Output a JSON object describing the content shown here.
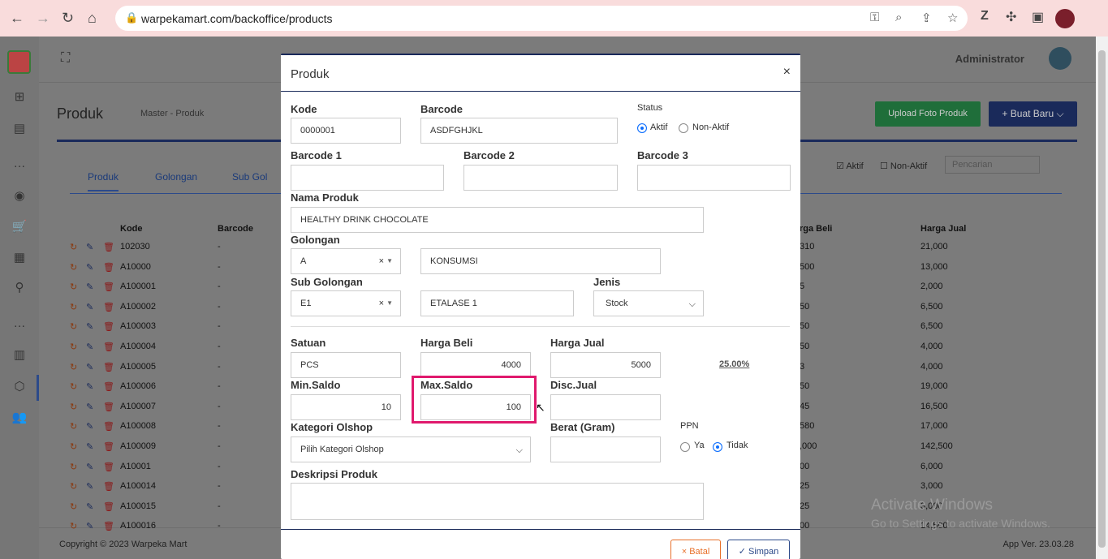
{
  "browser": {
    "url": "warpekamart.com/backoffice/products",
    "icons": [
      "back-icon",
      "forward-icon",
      "reload-icon",
      "home-icon",
      "lock-icon",
      "key-icon",
      "zoom-icon",
      "share-icon",
      "star-icon",
      "extension-z-icon",
      "puzzle-icon",
      "sidepanel-icon",
      "profile-icon"
    ]
  },
  "topbar": {
    "admin_label": "Administrator"
  },
  "page": {
    "title": "Produk",
    "breadcrumb": "Master   - Produk",
    "upload_button": "Upload Foto Produk",
    "new_button": "+ Buat Baru ⌵"
  },
  "tabs": [
    "Produk",
    "Golongan",
    "Sub Gol"
  ],
  "filters": {
    "aktif": "Aktif",
    "non_aktif": "Non-Aktif",
    "search_placeholder": "Pencarian"
  },
  "table": {
    "headers": {
      "kode": "Kode",
      "barcode": "Barcode",
      "harga_beli": "rga Beli",
      "harga_jual": "Harga Jual"
    },
    "rows": [
      {
        "kode": "102030",
        "barcode": "-",
        "beli": "310",
        "jual": "21,000"
      },
      {
        "kode": "A10000",
        "barcode": "-",
        "beli": "500",
        "jual": "13,000"
      },
      {
        "kode": "A100001",
        "barcode": "-",
        "beli": "5",
        "jual": "2,000"
      },
      {
        "kode": "A100002",
        "barcode": "-",
        "beli": "50",
        "jual": "6,500"
      },
      {
        "kode": "A100003",
        "barcode": "-",
        "beli": "50",
        "jual": "6,500"
      },
      {
        "kode": "A100004",
        "barcode": "-",
        "beli": "50",
        "jual": "4,000"
      },
      {
        "kode": "A100005",
        "barcode": "-",
        "beli": "3",
        "jual": "4,000"
      },
      {
        "kode": "A100006",
        "barcode": "-",
        "beli": "50",
        "jual": "19,000"
      },
      {
        "kode": "A100007",
        "barcode": "-",
        "beli": "45",
        "jual": "16,500"
      },
      {
        "kode": "A100008",
        "barcode": "-",
        "beli": "580",
        "jual": "17,000"
      },
      {
        "kode": "A100009",
        "barcode": "-",
        "beli": ",000",
        "jual": "142,500"
      },
      {
        "kode": "A10001",
        "barcode": "-",
        "beli": "00",
        "jual": "6,000"
      },
      {
        "kode": "A100014",
        "barcode": "-",
        "beli": "25",
        "jual": "3,000"
      },
      {
        "kode": "A100015",
        "barcode": "-",
        "beli": "25",
        "jual": "3,000"
      },
      {
        "kode": "A100016",
        "barcode": "-",
        "beli": "00",
        "jual": "14,500"
      }
    ]
  },
  "footer": {
    "copyright": "Copyright © 2023 Warpeka Mart",
    "version": "App Ver. 23.03.28"
  },
  "watermark": {
    "line1": "Activate Windows",
    "line2": "Go to Settings to activate Windows."
  },
  "modal": {
    "title": "Produk",
    "close": "×",
    "kode": {
      "label": "Kode",
      "value": "0000001"
    },
    "barcode": {
      "label": "Barcode",
      "value": "ASDFGHJKL"
    },
    "status": {
      "label": "Status",
      "aktif": "Aktif",
      "non_aktif": "Non-Aktif"
    },
    "barcode1": {
      "label": "Barcode 1",
      "value": ""
    },
    "barcode2": {
      "label": "Barcode 2",
      "value": ""
    },
    "barcode3": {
      "label": "Barcode 3",
      "value": ""
    },
    "nama_produk": {
      "label": "Nama Produk",
      "value": "HEALTHY DRINK CHOCOLATE"
    },
    "golongan": {
      "label": "Golongan",
      "code": "A",
      "name": "KONSUMSI"
    },
    "sub_golongan": {
      "label": "Sub Golongan",
      "code": "E1",
      "name": "ETALASE 1"
    },
    "jenis": {
      "label": "Jenis",
      "value": "Stock"
    },
    "satuan": {
      "label": "Satuan",
      "value": "PCS"
    },
    "harga_beli": {
      "label": "Harga Beli",
      "value": "4000"
    },
    "harga_jual": {
      "label": "Harga Jual",
      "value": "5000"
    },
    "margin": "25.00%",
    "min_saldo": {
      "label": "Min.Saldo",
      "value": "10"
    },
    "max_saldo": {
      "label": "Max.Saldo",
      "value": "100"
    },
    "disc_jual": {
      "label": "Disc.Jual",
      "value": ""
    },
    "kategori_olshop": {
      "label": "Kategori Olshop",
      "value": "Pilih Kategori Olshop"
    },
    "berat": {
      "label": "Berat (Gram)",
      "value": ""
    },
    "ppn": {
      "label": "PPN",
      "ya": "Ya",
      "tidak": "Tidak"
    },
    "deskripsi": {
      "label": "Deskripsi Produk",
      "value": ""
    },
    "batal_button": "× Batal",
    "simpan_button": "✓ Simpan"
  }
}
